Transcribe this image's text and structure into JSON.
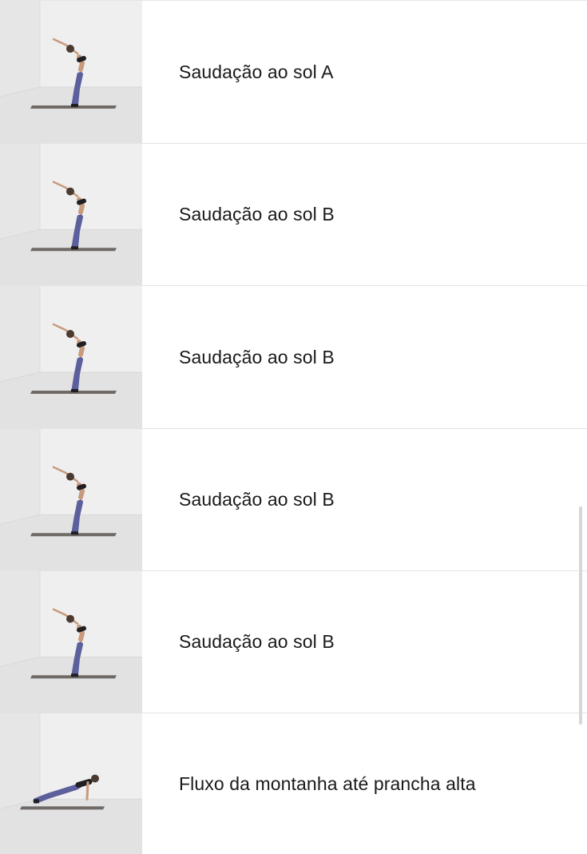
{
  "workout_list": {
    "items": [
      {
        "title": "Saudação ao sol A",
        "pose": "backbend"
      },
      {
        "title": "Saudação ao sol B",
        "pose": "backbend"
      },
      {
        "title": "Saudação ao sol B",
        "pose": "backbend"
      },
      {
        "title": "Saudação ao sol B",
        "pose": "backbend"
      },
      {
        "title": "Saudação ao sol B",
        "pose": "backbend"
      },
      {
        "title": "Fluxo da montanha até prancha alta",
        "pose": "plank"
      }
    ]
  },
  "colors": {
    "room_wall": "#efefef",
    "room_floor": "#e2e2e2",
    "mat": "#6f6a66",
    "leggings": "#5b5f9c",
    "skin": "#c89a7e",
    "top": "#1f1f24",
    "text": "#1a1a1a",
    "divider": "#e3e3e3"
  }
}
